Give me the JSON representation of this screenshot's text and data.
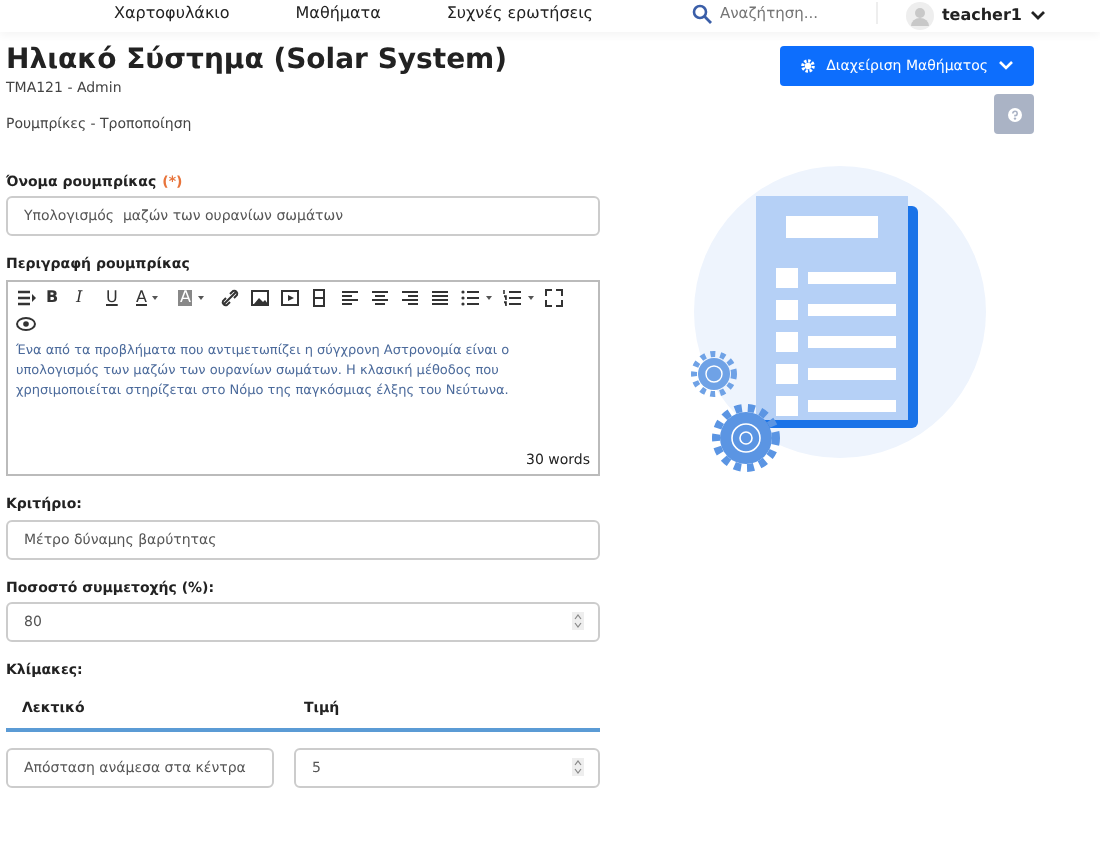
{
  "nav": {
    "items": [
      "Χαρτοφυλάκιο",
      "Μαθήματα",
      "Συχνές ερωτήσεις"
    ],
    "search": {
      "placeholder": "Αναζήτηση..."
    },
    "user": "teacher1"
  },
  "header": {
    "title": "Ηλιακό Σύστημα (Solar System)",
    "subtitle": "TMA121 - Admin",
    "breadcrumb": "Ρουμπρίκες - Τροποποίηση",
    "manage_button": "Διαχείριση Μαθήματος"
  },
  "form": {
    "name_label": "Όνομα ρουμπρίκας",
    "required_mark": "(*)",
    "name_value": "Υπολογισμός  μαζών των ουρανίων σωμάτων",
    "description_label": "Περιγραφή ρουμπρίκας",
    "toolbar": [
      {
        "kind": "paragraph"
      },
      {
        "kind": "bold",
        "label": "B"
      },
      {
        "kind": "italic",
        "label": "I"
      },
      {
        "kind": "underline",
        "label": "U"
      },
      {
        "kind": "color",
        "label": "A"
      },
      {
        "kind": "highlight",
        "label": "A"
      },
      {
        "kind": "link"
      },
      {
        "kind": "image"
      },
      {
        "kind": "video"
      },
      {
        "kind": "table"
      },
      {
        "kind": "align-left"
      },
      {
        "kind": "align-center"
      },
      {
        "kind": "align-right"
      },
      {
        "kind": "justify"
      },
      {
        "kind": "bullets"
      },
      {
        "kind": "numbers"
      },
      {
        "kind": "fullscreen"
      },
      {
        "kind": "preview"
      }
    ],
    "description": "Ένα από τα προβλήματα που αντιμετωπίζει η σύγχρονη Αστρονομία είναι ο υπολογισμός των  μαζών των ουρανίων σωμάτων. Η κλασική μέθοδος που χρησιμοποιείται στηρίζεται στο Νόμο της παγκόσμιας έλξης του Νεύτωνα.",
    "word_count": "30 words",
    "criterion_label": "Κριτήριο:",
    "criterion_value": "Μέτρο δύναμης βαρύτητας",
    "percent_label": "Ποσοστό συμμετοχής (%):",
    "percent_value": "80",
    "scales_label": "Κλίμακες:",
    "scale_columns": [
      "Λεκτικό",
      "Τιμή"
    ],
    "scales": [
      {
        "text": "Απόσταση ανάμεσα στα κέντρα",
        "value": "5"
      }
    ]
  }
}
